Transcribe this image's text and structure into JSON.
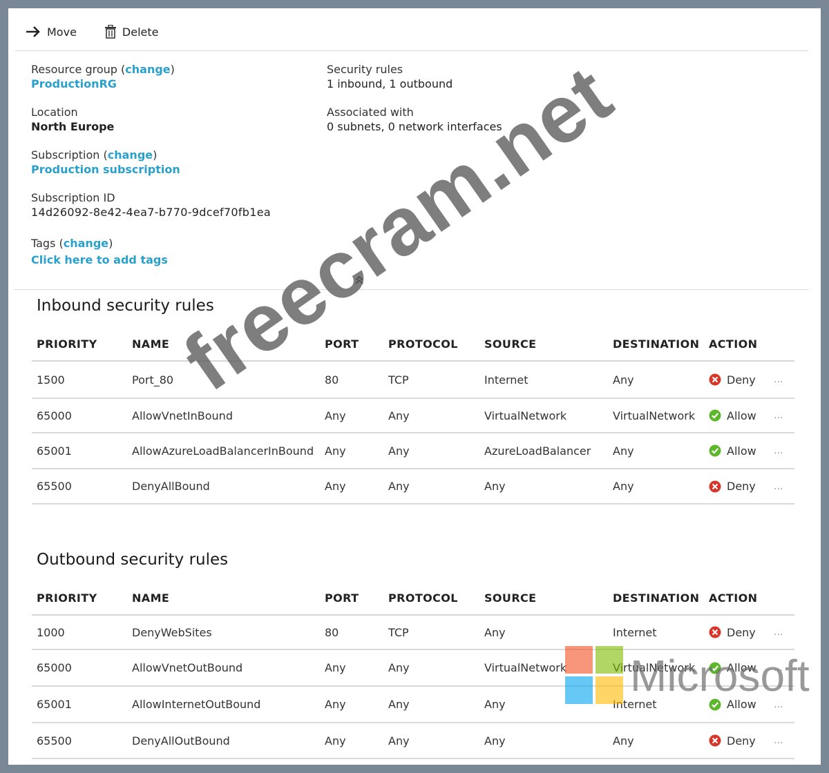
{
  "toolbar": {
    "move_label": "Move",
    "delete_label": "Delete"
  },
  "essentials": {
    "resource_group": {
      "label": "Resource group",
      "change": "change",
      "value": "ProductionRG"
    },
    "location": {
      "label": "Location",
      "value": "North Europe"
    },
    "subscription": {
      "label": "Subscription",
      "change": "change",
      "value": "Production subscription"
    },
    "subscription_id": {
      "label": "Subscription ID",
      "value": "14d26092-8e42-4ea7-b770-9dcef70fb1ea"
    },
    "tags": {
      "label": "Tags",
      "change": "change",
      "value": "Click here to add tags"
    },
    "security_rules": {
      "label": "Security rules",
      "value": "1 inbound, 1 outbound"
    },
    "associated_with": {
      "label": "Associated with",
      "value": "0 subnets, 0 network interfaces"
    }
  },
  "columns": {
    "priority": "PRIORITY",
    "name": "NAME",
    "port": "PORT",
    "protocol": "PROTOCOL",
    "source": "SOURCE",
    "destination": "DESTINATION",
    "action": "ACTION"
  },
  "inbound": {
    "title": "Inbound security rules",
    "rows": [
      {
        "priority": "1500",
        "name": "Port_80",
        "port": "80",
        "protocol": "TCP",
        "source": "Internet",
        "destination": "Any",
        "action": "Deny"
      },
      {
        "priority": "65000",
        "name": "AllowVnetInBound",
        "port": "Any",
        "protocol": "Any",
        "source": "VirtualNetwork",
        "destination": "VirtualNetwork",
        "action": "Allow"
      },
      {
        "priority": "65001",
        "name": "AllowAzureLoadBalancerInBound",
        "port": "Any",
        "protocol": "Any",
        "source": "AzureLoadBalancer",
        "destination": "Any",
        "action": "Allow"
      },
      {
        "priority": "65500",
        "name": "DenyAllBound",
        "port": "Any",
        "protocol": "Any",
        "source": "Any",
        "destination": "Any",
        "action": "Deny"
      }
    ]
  },
  "outbound": {
    "title": "Outbound security rules",
    "rows": [
      {
        "priority": "1000",
        "name": "DenyWebSites",
        "port": "80",
        "protocol": "TCP",
        "source": "Any",
        "destination": "Internet",
        "action": "Deny"
      },
      {
        "priority": "65000",
        "name": "AllowVnetOutBound",
        "port": "Any",
        "protocol": "Any",
        "source": "VirtualNetwork",
        "destination": "VirtualNetwork",
        "action": "Allow"
      },
      {
        "priority": "65001",
        "name": "AllowInternetOutBound",
        "port": "Any",
        "protocol": "Any",
        "source": "Any",
        "destination": "Internet",
        "action": "Allow"
      },
      {
        "priority": "65500",
        "name": "DenyAllOutBound",
        "port": "Any",
        "protocol": "Any",
        "source": "Any",
        "destination": "Any",
        "action": "Deny"
      }
    ]
  },
  "more_label": "...",
  "watermark": {
    "text": "freecram.net",
    "logo_text": "Microsoft"
  },
  "colors": {
    "link": "#2aa0cc",
    "deny": "#d9362b",
    "allow": "#5cb82a",
    "ms_red": "#f25022",
    "ms_green": "#7fba00",
    "ms_blue": "#00a4ef",
    "ms_yellow": "#ffb900"
  }
}
